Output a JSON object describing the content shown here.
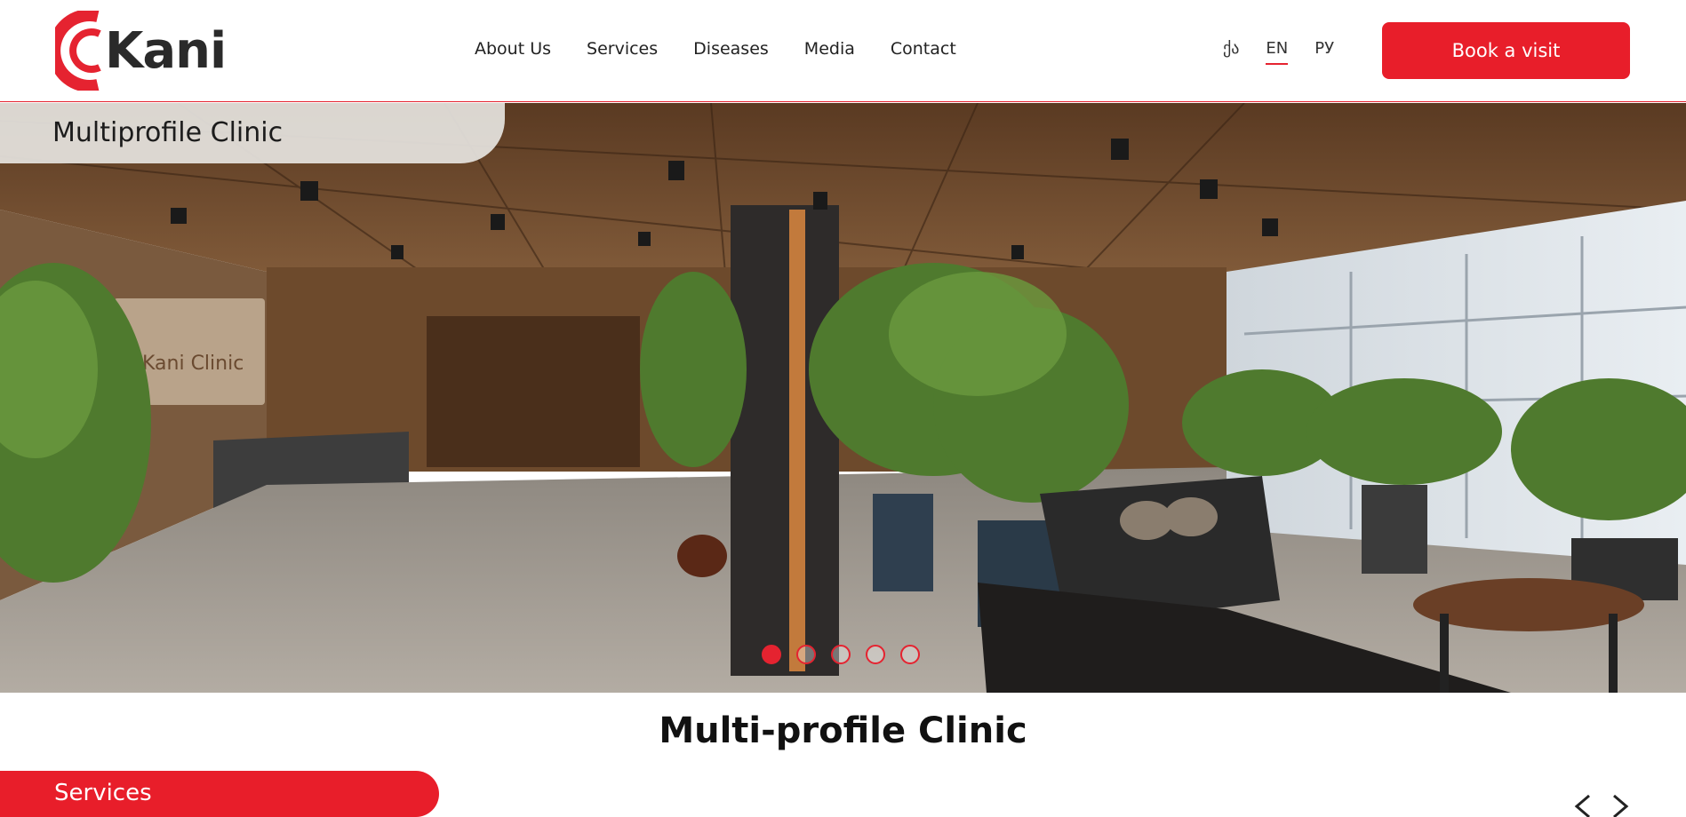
{
  "header": {
    "logo_text": "Kani",
    "nav": [
      {
        "label": "About Us"
      },
      {
        "label": "Services"
      },
      {
        "label": "Diseases"
      },
      {
        "label": "Media"
      },
      {
        "label": "Contact"
      }
    ],
    "languages": [
      {
        "label": "ქა",
        "active": false
      },
      {
        "label": "EN",
        "active": true
      },
      {
        "label": "РУ",
        "active": false
      }
    ],
    "book_button": "Book a visit"
  },
  "hero": {
    "tag": "Multiprofile Clinic",
    "slides_count": 5,
    "active_slide": 1,
    "sign_text": "Kani Clinic"
  },
  "main": {
    "title": "Multi-profile Clinic",
    "services_tab": "Services"
  },
  "colors": {
    "accent": "#e81e2a",
    "text": "#1f1f1f"
  },
  "icons": [
    "kani-logo-icon",
    "arrow-left-icon",
    "arrow-right-icon"
  ]
}
